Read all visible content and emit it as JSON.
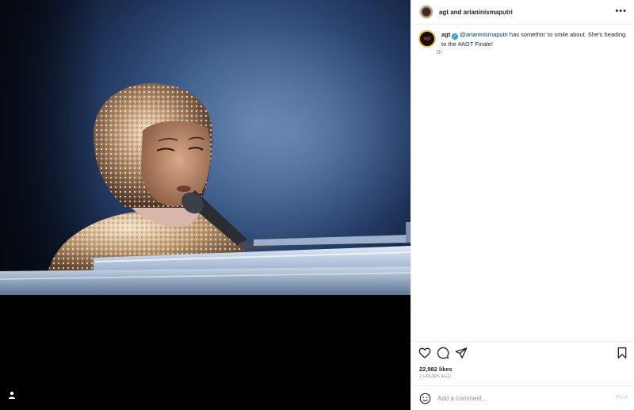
{
  "header": {
    "names": "agt and arianinismaputri"
  },
  "caption": {
    "username": "agt",
    "verified_mark": "✓",
    "mention": "@arianinismaputri",
    "text_before_hashtag": " has somethin' to smile about. She's heading to the ",
    "hashtag": "#AGT",
    "text_after_hashtag": " Finale!",
    "time": "2h",
    "avatar_text": "agt"
  },
  "stats": {
    "likes": "22,982 likes",
    "age": "2 HOURS AGO"
  },
  "comment": {
    "placeholder": "Add a comment...",
    "post_label": "Post"
  },
  "icons": {
    "more": "more-options-icon",
    "like": "heart-icon",
    "comment": "comment-icon",
    "share": "share-icon",
    "save": "bookmark-icon",
    "emoji": "emoji-icon",
    "user_tag": "user-tag-icon"
  },
  "colors": {
    "link": "#00376b",
    "verified": "#3897f0",
    "post_button_disabled": "#c7e0f4",
    "muted": "#8e8e8e"
  }
}
